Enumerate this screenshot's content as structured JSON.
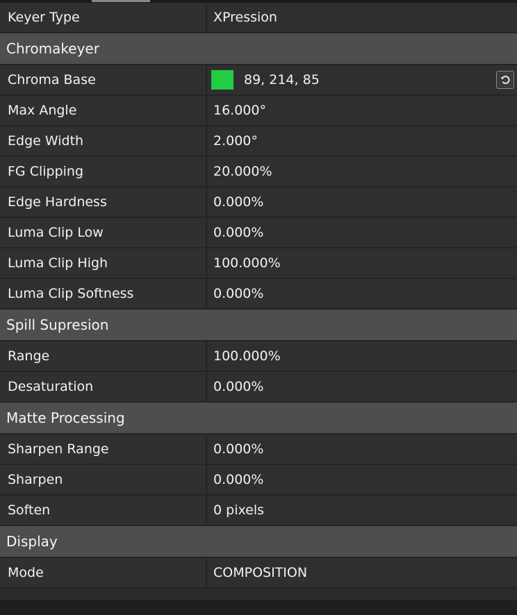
{
  "header": {
    "label": "Keyer Type",
    "value": "XPression"
  },
  "sections": [
    {
      "title": "Chromakeyer",
      "rows": [
        {
          "label": "Chroma Base",
          "value": "89, 214, 85",
          "swatch": "#22cc44",
          "reset_icon": "reset-icon"
        },
        {
          "label": "Max Angle",
          "value": "16.000°"
        },
        {
          "label": "Edge Width",
          "value": "2.000°"
        },
        {
          "label": "FG Clipping",
          "value": "20.000%"
        },
        {
          "label": "Edge Hardness",
          "value": "0.000%"
        },
        {
          "label": "Luma Clip Low",
          "value": "0.000%"
        },
        {
          "label": "Luma Clip High",
          "value": "100.000%"
        },
        {
          "label": "Luma Clip Softness",
          "value": "0.000%"
        }
      ]
    },
    {
      "title": "Spill Supresion",
      "rows": [
        {
          "label": "Range",
          "value": "100.000%"
        },
        {
          "label": "Desaturation",
          "value": "0.000%"
        }
      ]
    },
    {
      "title": "Matte Processing",
      "rows": [
        {
          "label": "Sharpen Range",
          "value": "0.000%"
        },
        {
          "label": "Sharpen",
          "value": "0.000%"
        },
        {
          "label": "Soften",
          "value": "0 pixels"
        }
      ]
    },
    {
      "title": "Display",
      "rows": [
        {
          "label": "Mode",
          "value": "COMPOSITION"
        }
      ]
    }
  ],
  "colors": {
    "section_bg": "#4e4e4e",
    "row_bg": "#303030",
    "accent_swatch": "#22cc44"
  }
}
